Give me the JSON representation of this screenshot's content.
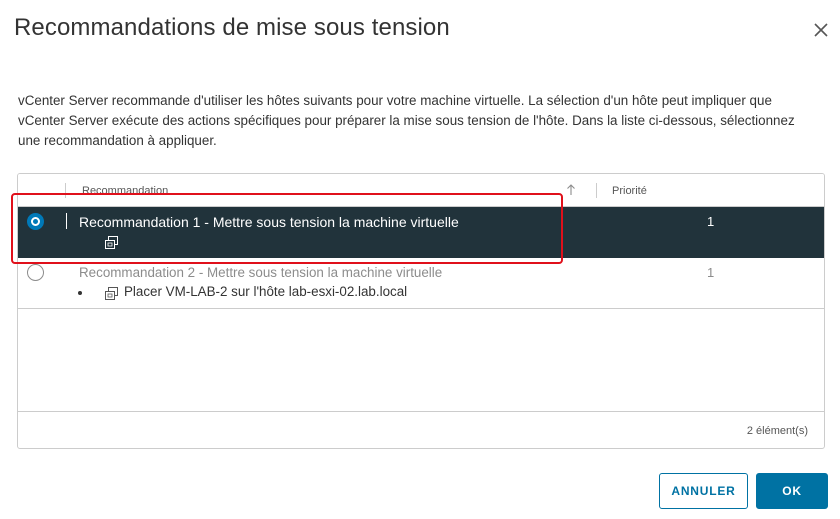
{
  "dialog": {
    "title": "Recommandations de mise sous tension",
    "close_icon": "close-icon",
    "description": "vCenter Server recommande d'utiliser les hôtes suivants pour votre machine virtuelle. La sélection d'un hôte peut impliquer que vCenter Server exécute des actions spécifiques pour préparer la mise sous tension de l'hôte. Dans la liste ci-dessous, sélectionnez une recommandation à appliquer."
  },
  "grid": {
    "columns": [
      "Recommandation",
      "Priorité"
    ],
    "sort_icon": "arrow-up-icon",
    "rows": [
      {
        "title": "Recommandation 1 - Mettre sous tension la machine virtuelle",
        "priority": "1",
        "selected": true,
        "icon": "vm-icon",
        "sub_action": ""
      },
      {
        "title": "Recommandation 2 - Mettre sous tension la machine virtuelle",
        "priority": "1",
        "selected": false,
        "icon": "vm-icon",
        "sub_action": "Placer VM-LAB-2 sur l'hôte lab-esxi-02.lab.local"
      }
    ],
    "footer": "2 élément(s)"
  },
  "buttons": {
    "cancel": "ANNULER",
    "ok": "OK"
  },
  "colors": {
    "selected_row": "#21333b",
    "primary": "#0072a3",
    "highlight": "#e0101b"
  }
}
